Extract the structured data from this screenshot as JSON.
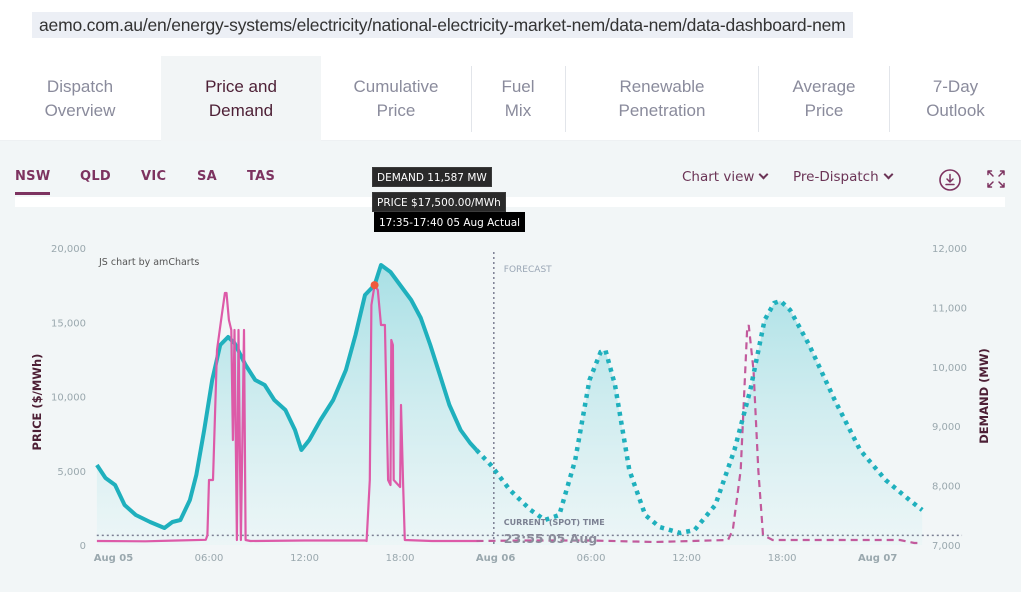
{
  "browser": {
    "url": "aemo.com.au/en/energy-systems/electricity/national-electricity-market-nem/data-nem/data-dashboard-nem"
  },
  "tabs": [
    {
      "line1": "Dispatch",
      "line2": "Overview",
      "active": false
    },
    {
      "line1": "Price and",
      "line2": "Demand",
      "active": true
    },
    {
      "line1": "Cumulative",
      "line2": "Price",
      "active": false
    },
    {
      "line1": "Fuel",
      "line2": "Mix",
      "active": false
    },
    {
      "line1": "Renewable",
      "line2": "Penetration",
      "active": false
    },
    {
      "line1": "Average",
      "line2": "Price",
      "active": false
    },
    {
      "line1": "7-Day",
      "line2": "Outlook",
      "active": false
    }
  ],
  "regions": [
    {
      "label": "NSW",
      "active": true
    },
    {
      "label": "QLD",
      "active": false
    },
    {
      "label": "VIC",
      "active": false
    },
    {
      "label": "SA",
      "active": false
    },
    {
      "label": "TAS",
      "active": false
    }
  ],
  "controls": {
    "chart_view_label": "Chart view",
    "dispatch_label": "Pre-Dispatch",
    "download_icon": "download-icon",
    "fullscreen_icon": "fullscreen-icon"
  },
  "tooltip": {
    "demand": "DEMAND 11,587 MW",
    "price": "PRICE $17,500.00/MWh",
    "time": "17:35-17:40 05 Aug Actual"
  },
  "colors": {
    "demand": "#1fb0bd",
    "price": "#dd5aa8",
    "price_forecast": "#c25a9c",
    "accent": "#7d3360",
    "marker": "#f05a3c"
  },
  "chart_data": {
    "type": "line",
    "credit": "JS chart by amCharts",
    "x_unit": "hours since Aug 05 00:00",
    "x_ticks": [
      {
        "h": 0,
        "label": "Aug 05",
        "bold": true
      },
      {
        "h": 6,
        "label": "06:00",
        "bold": false
      },
      {
        "h": 12,
        "label": "12:00",
        "bold": false
      },
      {
        "h": 18,
        "label": "18:00",
        "bold": false
      },
      {
        "h": 24,
        "label": "Aug 06",
        "bold": true
      },
      {
        "h": 30,
        "label": "06:00",
        "bold": false
      },
      {
        "h": 36,
        "label": "12:00",
        "bold": false
      },
      {
        "h": 42,
        "label": "18:00",
        "bold": false
      },
      {
        "h": 48,
        "label": "Aug 07",
        "bold": true
      }
    ],
    "xlim": [
      -1.05,
      53.3
    ],
    "y_left": {
      "label": "PRICE ($/MWh)",
      "ylim": [
        0,
        20000
      ],
      "ticks": [
        "0",
        "5,000",
        "10,000",
        "15,000",
        "20,000"
      ],
      "tick_values": [
        0,
        5000,
        10000,
        15000,
        20000
      ]
    },
    "y_right": {
      "label": "DEMAND (MW)",
      "ylim": [
        7000,
        12000
      ],
      "ticks": [
        "7,000",
        "8,000",
        "9,000",
        "10,000",
        "11,000",
        "12,000"
      ],
      "tick_values": [
        7000,
        8000,
        9000,
        10000,
        11000,
        12000
      ]
    },
    "forecast_label": "FORECAST",
    "forecast_start_h": 23.92,
    "spot_label": "CURRENT (SPOT) TIME",
    "spot_time": "23:55 05 Aug",
    "spot_price": 650,
    "highlight": {
      "h": 16.4,
      "price": 17500
    },
    "series": [
      {
        "name": "Demand (actual)",
        "axis": "right",
        "style": "solid",
        "points": [
          [
            -1.04,
            8347
          ],
          [
            -0.5,
            8128
          ],
          [
            0.1,
            8010
          ],
          [
            0.7,
            7673
          ],
          [
            1.4,
            7505
          ],
          [
            2.3,
            7387
          ],
          [
            3.2,
            7286
          ],
          [
            3.7,
            7387
          ],
          [
            4.2,
            7421
          ],
          [
            4.8,
            7758
          ],
          [
            5.2,
            8178
          ],
          [
            5.7,
            8936
          ],
          [
            6.2,
            9778
          ],
          [
            6.7,
            10367
          ],
          [
            7.2,
            10502
          ],
          [
            7.6,
            10401
          ],
          [
            8.3,
            10030
          ],
          [
            8.9,
            9778
          ],
          [
            9.5,
            9694
          ],
          [
            10.1,
            9441
          ],
          [
            10.8,
            9273
          ],
          [
            11.4,
            8936
          ],
          [
            11.8,
            8599
          ],
          [
            12.3,
            8768
          ],
          [
            13.0,
            9104
          ],
          [
            13.8,
            9441
          ],
          [
            14.6,
            9946
          ],
          [
            15.2,
            10535
          ],
          [
            15.8,
            11209
          ],
          [
            16.4,
            11377
          ],
          [
            16.8,
            11714
          ],
          [
            17.4,
            11596
          ],
          [
            18.0,
            11377
          ],
          [
            18.7,
            11125
          ],
          [
            19.3,
            10822
          ],
          [
            19.9,
            10367
          ],
          [
            20.5,
            9862
          ],
          [
            21.1,
            9357
          ],
          [
            21.8,
            8936
          ],
          [
            22.4,
            8717
          ],
          [
            22.8,
            8599
          ]
        ]
      },
      {
        "name": "Demand (forecast)",
        "axis": "right",
        "style": "dotted",
        "points": [
          [
            22.8,
            8599
          ],
          [
            23.7,
            8347
          ],
          [
            24.9,
            7926
          ],
          [
            26.2,
            7589
          ],
          [
            27.1,
            7421
          ],
          [
            28.0,
            7505
          ],
          [
            29.0,
            8431
          ],
          [
            29.9,
            9778
          ],
          [
            30.6,
            10249
          ],
          [
            30.9,
            10283
          ],
          [
            31.5,
            9694
          ],
          [
            32.4,
            8263
          ],
          [
            33.4,
            7505
          ],
          [
            34.3,
            7303
          ],
          [
            35.6,
            7202
          ],
          [
            36.5,
            7252
          ],
          [
            37.8,
            7673
          ],
          [
            39.0,
            8599
          ],
          [
            40.0,
            9609
          ],
          [
            40.9,
            10788
          ],
          [
            41.5,
            11074
          ],
          [
            41.9,
            11108
          ],
          [
            42.5,
            10956
          ],
          [
            43.7,
            10367
          ],
          [
            45.3,
            9441
          ],
          [
            46.9,
            8599
          ],
          [
            48.5,
            8094
          ],
          [
            50.0,
            7758
          ],
          [
            50.8,
            7589
          ]
        ]
      },
      {
        "name": "Price (actual)",
        "axis": "left",
        "style": "solid",
        "points": [
          [
            -1.04,
            270
          ],
          [
            2,
            250
          ],
          [
            4,
            300
          ],
          [
            5.8,
            350
          ],
          [
            5.9,
            670
          ],
          [
            6.0,
            4377
          ],
          [
            6.25,
            4377
          ],
          [
            6.5,
            13131
          ],
          [
            6.8,
            15488
          ],
          [
            7.0,
            16970
          ],
          [
            7.1,
            16970
          ],
          [
            7.25,
            15152
          ],
          [
            7.4,
            14478
          ],
          [
            7.5,
            7071
          ],
          [
            7.6,
            14478
          ],
          [
            7.75,
            337
          ],
          [
            7.85,
            14478
          ],
          [
            8.0,
            337
          ],
          [
            8.2,
            14478
          ],
          [
            8.3,
            337
          ],
          [
            8.6,
            270
          ],
          [
            12,
            300
          ],
          [
            15.8,
            300
          ],
          [
            15.9,
            270
          ],
          [
            16.1,
            4377
          ],
          [
            16.2,
            16162
          ],
          [
            16.4,
            17500
          ],
          [
            16.6,
            17172
          ],
          [
            16.8,
            14815
          ],
          [
            17.05,
            14815
          ],
          [
            17.25,
            4377
          ],
          [
            17.4,
            4040
          ],
          [
            17.45,
            13805
          ],
          [
            17.55,
            13468
          ],
          [
            17.6,
            4377
          ],
          [
            18.0,
            3906
          ],
          [
            18.06,
            9428
          ],
          [
            18.2,
            3906
          ],
          [
            18.3,
            337
          ],
          [
            20,
            270
          ],
          [
            22.8,
            270
          ]
        ]
      },
      {
        "name": "Price (forecast)",
        "axis": "left",
        "style": "dashed",
        "points": [
          [
            22.8,
            270
          ],
          [
            26,
            300
          ],
          [
            30,
            300
          ],
          [
            34,
            200
          ],
          [
            38.6,
            337
          ],
          [
            38.9,
            1010
          ],
          [
            39.4,
            5051
          ],
          [
            39.8,
            14478
          ],
          [
            39.9,
            14815
          ],
          [
            40.2,
            11785
          ],
          [
            40.5,
            5051
          ],
          [
            40.8,
            673
          ],
          [
            41.4,
            337
          ],
          [
            45,
            337
          ],
          [
            49.4,
            337
          ],
          [
            50.3,
            135
          ],
          [
            50.8,
            135
          ]
        ]
      }
    ]
  }
}
